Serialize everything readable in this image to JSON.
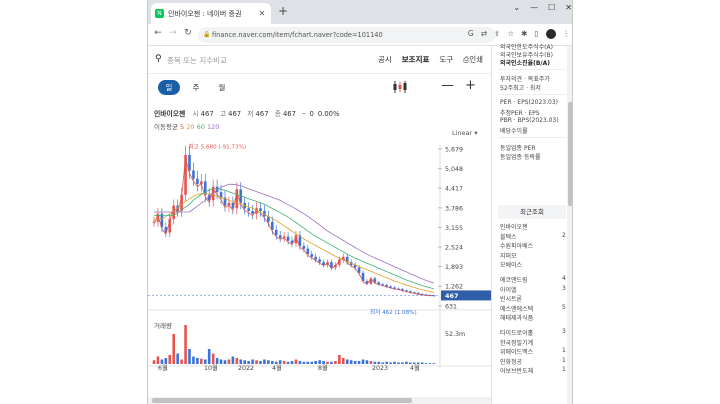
{
  "browser": {
    "tab_title": "인바이오젠 : 네이버 증권",
    "favicon": "N",
    "url": "finance.naver.com/item/fchart.naver?code=101140"
  },
  "toolbar": {
    "search_placeholder": "종목 또는 지수비교",
    "links": [
      "공시",
      "보조지표",
      "도구",
      "인쇄"
    ]
  },
  "periods": [
    {
      "label": "일",
      "active": true
    },
    {
      "label": "주",
      "active": false
    },
    {
      "label": "월",
      "active": false
    }
  ],
  "quote": {
    "name": "인바이오젠",
    "open_label": "시",
    "open": "467",
    "high_label": "고",
    "high": "467",
    "low_label": "저",
    "low": "467",
    "close": "467",
    "change": "0",
    "change_pct": "0.00%",
    "change_arrow": "–"
  },
  "moving_avg": {
    "label": "이동평균",
    "values": [
      "5",
      "20",
      "60",
      "120"
    ]
  },
  "scale_label": "Linear",
  "chart_data": {
    "type": "line",
    "y_ticks": [
      "5,679",
      "5,048",
      "4,417",
      "3,786",
      "3,155",
      "2,524",
      "1,893",
      "1,262",
      "631"
    ],
    "x_ticks": [
      "6월",
      "10월",
      "2022",
      "4월",
      "8월",
      "2023",
      "4월"
    ],
    "max_annotation": "최고 5,680 (-91.73%)",
    "min_annotation": "최저 462 (1.08%)",
    "last_price": "467",
    "volume_label": "거래량",
    "volume_max": "52.3m",
    "price_series": [
      3200,
      3500,
      3000,
      2800,
      3300,
      3800,
      3600,
      4200,
      5680,
      5100,
      4800,
      4600,
      4700,
      4200,
      4000,
      4500,
      4300,
      4100,
      3800,
      3900,
      3700,
      4400,
      3900,
      3700,
      3600,
      3500,
      3700,
      3600,
      3400,
      3200,
      2900,
      2700,
      2600,
      2650,
      2500,
      2400,
      2700,
      2300,
      2200,
      2000,
      1900,
      1800,
      1700,
      1600,
      1700,
      1500,
      1600,
      1800,
      1900,
      1700,
      1600,
      1500,
      1300,
      1000,
      900,
      1100,
      950,
      880,
      850,
      800,
      760,
      720,
      700,
      650,
      620,
      580,
      560,
      520,
      500,
      480,
      470,
      467
    ],
    "ma_series": [
      3300,
      3400,
      3500,
      3600,
      3700,
      3850,
      3950,
      4050,
      4150,
      4200,
      4250,
      4250,
      4230,
      4200,
      4150,
      4100,
      4050,
      4000,
      3950,
      3900,
      3850,
      3800,
      3750,
      3700,
      3620,
      3550,
      3480,
      3400,
      3320,
      3240,
      3150,
      3050,
      2950,
      2850,
      2750,
      2650,
      2560,
      2480,
      2400,
      2320,
      2240,
      2160,
      2080,
      2000,
      1920,
      1850,
      1780,
      1720,
      1660,
      1600,
      1540,
      1480,
      1420,
      1360,
      1300,
      1240,
      1180,
      1120,
      1060,
      1000,
      950,
      900,
      850,
      800,
      760,
      720,
      680,
      640,
      610,
      580,
      560,
      540
    ],
    "volume_series": [
      5,
      10,
      6,
      8,
      12,
      40,
      14,
      6,
      52,
      20,
      10,
      8,
      7,
      6,
      20,
      14,
      8,
      6,
      5,
      6,
      10,
      8,
      6,
      5,
      4,
      6,
      5,
      4,
      6,
      5,
      4,
      3,
      5,
      4,
      3,
      4,
      6,
      4,
      3,
      3,
      3,
      4,
      5,
      4,
      3,
      3,
      4,
      12,
      8,
      6,
      5,
      4,
      4,
      6,
      5,
      4,
      3,
      3,
      2,
      3,
      2,
      3,
      2,
      2,
      3,
      2,
      2,
      2,
      2,
      1,
      1,
      1
    ],
    "colors": {
      "up": "#e8534f",
      "down": "#3b73d9",
      "ma5": "#d9534f",
      "ma20": "#e0a020",
      "ma60": "#3cb371",
      "ma120": "#a070c0"
    }
  },
  "sidebar": {
    "top_items": [
      "외국인한도주식수(A)",
      "외국인보유주식수(B)",
      "외국인소진율(B/A)"
    ],
    "invest_items": [
      "투자의견 · 목표주가",
      "52주최고 · 최저"
    ],
    "per_items": [
      "PER · EPS(2023.03)",
      "추정PER · EPS",
      "PBR · BPS(2023.03)",
      "배당수익률"
    ],
    "industry_items": [
      "동일업종 PER",
      "동일업종 등락률"
    ],
    "recent_title": "최근조회",
    "recent_items": [
      "인바이오젠",
      "블텍스",
      "수원피아베스",
      "지퍼모",
      "모베이스"
    ],
    "recent_items2": [
      "에코앤드림",
      "아이엘",
      "빈시트론",
      "에스엔에스텍",
      "해태제과식품"
    ],
    "recent_counts": [
      "",
      "2",
      "",
      "",
      ""
    ],
    "recent_counts2": [
      "4",
      "3",
      "",
      "5",
      ""
    ],
    "recent_items3": [
      "타이드로이홀",
      "한국정밀기계",
      "위메이드맥스",
      "인화정공",
      "어보브반도체"
    ],
    "recent_counts3": [
      "3",
      "",
      "1",
      "1",
      "1"
    ]
  }
}
